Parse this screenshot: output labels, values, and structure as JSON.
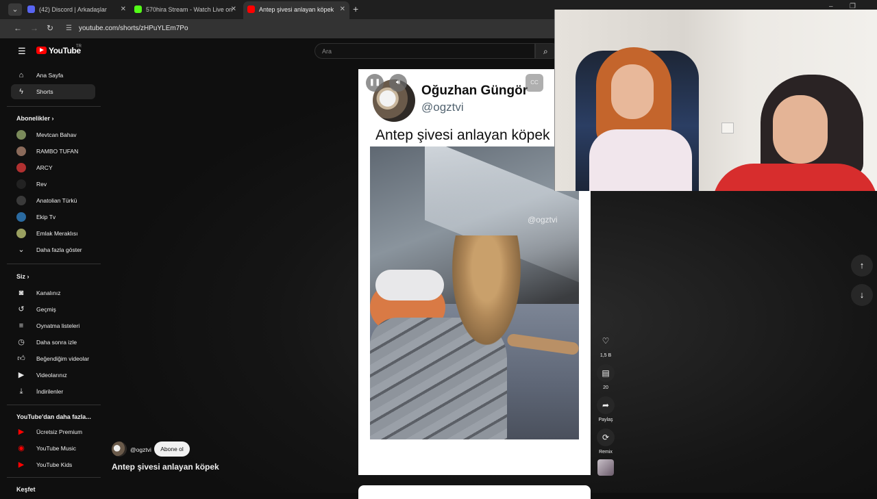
{
  "browser": {
    "tabs": [
      {
        "title": "(42) Discord | Arkadaşlar",
        "color": "#5865F2"
      },
      {
        "title": "570hira Stream - Watch Live on",
        "color": "#53FC18"
      },
      {
        "title": "Antep şivesi anlayan köpek",
        "color": "#FF0000"
      }
    ],
    "url": "youtube.com/shorts/zHPuYLEm7Po"
  },
  "youtube": {
    "logo_word": "YouTube",
    "region": "TR",
    "search_placeholder": "Ara"
  },
  "sidebar": {
    "main": [
      {
        "label": "Ana Sayfa",
        "icon": "home-icon"
      },
      {
        "label": "Shorts",
        "icon": "shorts-icon"
      }
    ],
    "subscriptions_title": "Abonelikler",
    "subscriptions": [
      {
        "label": "Mevtcan Bahav",
        "color": "#7a8a5a"
      },
      {
        "label": "RAMBO TUFAN",
        "color": "#8a6a5a"
      },
      {
        "label": "ARCY",
        "color": "#b03030"
      },
      {
        "label": "Rev",
        "color": "#222222"
      },
      {
        "label": "Anatolian Türkü",
        "color": "#3a3a3a"
      },
      {
        "label": "Ekip Tv",
        "color": "#2a6aa0"
      },
      {
        "label": "Emlak Meraklısı",
        "color": "#9aa060"
      }
    ],
    "show_more": "Daha fazla göster",
    "you_title": "Siz",
    "you": [
      {
        "label": "Kanalınız",
        "icon": "channel-icon"
      },
      {
        "label": "Geçmiş",
        "icon": "history-icon"
      },
      {
        "label": "Oynatma listeleri",
        "icon": "playlist-icon"
      },
      {
        "label": "Daha sonra izle",
        "icon": "clock-icon"
      },
      {
        "label": "Beğendiğim videolar",
        "icon": "thumb-up-icon"
      },
      {
        "label": "Videolarınız",
        "icon": "video-icon"
      },
      {
        "label": "İndirilenler",
        "icon": "download-icon"
      }
    ],
    "more_title": "YouTube'dan daha fazla...",
    "more": [
      {
        "label": "Ücretsiz Premium"
      },
      {
        "label": "YouTube Music"
      },
      {
        "label": "YouTube Kids"
      }
    ],
    "explore_title": "Keşfet"
  },
  "short": {
    "tweet_name": "Oğuzhan Güngör",
    "tweet_handle": "@ogztvi",
    "tweet_text": "Antep şivesi anlayan köpek",
    "watermark": "@ogztvi",
    "channel": "@ogztvi",
    "subscribe_label": "Abone ol",
    "title": "Antep şivesi anlayan köpek",
    "likes": "1,5 B",
    "comments": "20",
    "share_label": "Paylaş",
    "remix_label": "Remix"
  }
}
